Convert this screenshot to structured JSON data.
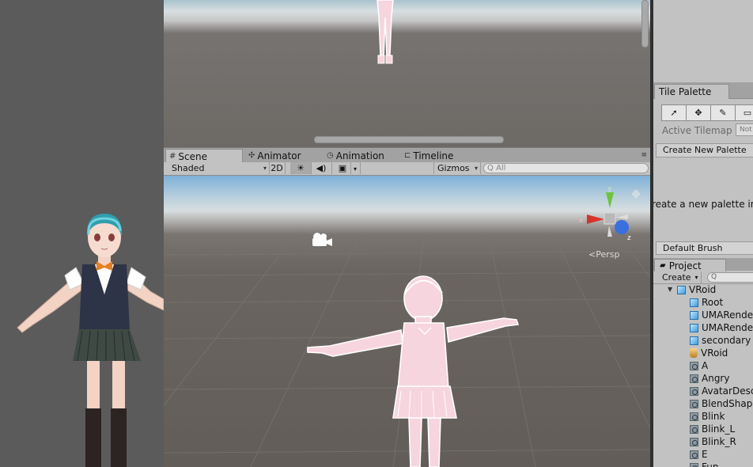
{
  "tabs": [
    {
      "label": "Scene",
      "icon": "scene-tab-icon",
      "active": true
    },
    {
      "label": "Animator",
      "icon": "animator-tab-icon",
      "active": false
    },
    {
      "label": "Animation",
      "icon": "animation-tab-icon",
      "active": false
    },
    {
      "label": "Timeline",
      "icon": "timeline-tab-icon",
      "active": false
    }
  ],
  "toolbar": {
    "shading_mode": "Shaded",
    "mode_2d": "2D",
    "gizmos": "Gizmos",
    "search_placeholder": "All",
    "search_prefix": "Q"
  },
  "scene": {
    "projection_label": "Persp",
    "gizmo_axes": {
      "y": "y",
      "x": "x",
      "z": "z"
    }
  },
  "tile_palette": {
    "tab_label": "Tile Palette",
    "active_tilemap_label": "Active Tilemap",
    "active_tilemap_value": "Not",
    "create_new_palette": "Create New Palette",
    "hint_text": "reate a new palette in",
    "default_brush": "Default Brush"
  },
  "project": {
    "tab_label": "Project",
    "create_label": "Create",
    "search_placeholder": "Q",
    "items": [
      {
        "label": "VRoid",
        "icon": "model-icon",
        "level": 0,
        "expanded": true
      },
      {
        "label": "Root",
        "icon": "cube-icon",
        "level": 1
      },
      {
        "label": "UMARender",
        "icon": "cube-icon",
        "level": 1
      },
      {
        "label": "UMARender",
        "icon": "cube-icon",
        "level": 1
      },
      {
        "label": "secondary",
        "icon": "cube-icon",
        "level": 1
      },
      {
        "label": "VRoid",
        "icon": "prefab-icon",
        "level": 1
      },
      {
        "label": "A",
        "icon": "animation-clip-icon",
        "level": 1
      },
      {
        "label": "Angry",
        "icon": "animation-clip-icon",
        "level": 1
      },
      {
        "label": "AvatarDesc",
        "icon": "animation-clip-icon",
        "level": 1
      },
      {
        "label": "BlendShape",
        "icon": "animation-clip-icon",
        "level": 1
      },
      {
        "label": "Blink",
        "icon": "animation-clip-icon",
        "level": 1
      },
      {
        "label": "Blink_L",
        "icon": "animation-clip-icon",
        "level": 1
      },
      {
        "label": "Blink_R",
        "icon": "animation-clip-icon",
        "level": 1
      },
      {
        "label": "E",
        "icon": "animation-clip-icon",
        "level": 1
      },
      {
        "label": "Fun",
        "icon": "animation-clip-icon",
        "level": 1
      }
    ]
  },
  "colors": {
    "editor_bg": "#c2c2c2",
    "divider": "#303030",
    "gizmo_y": "#6fc43c",
    "gizmo_x": "#d8332a",
    "gizmo_z": "#3a6fe0",
    "model_pink": "#f7d5de"
  }
}
